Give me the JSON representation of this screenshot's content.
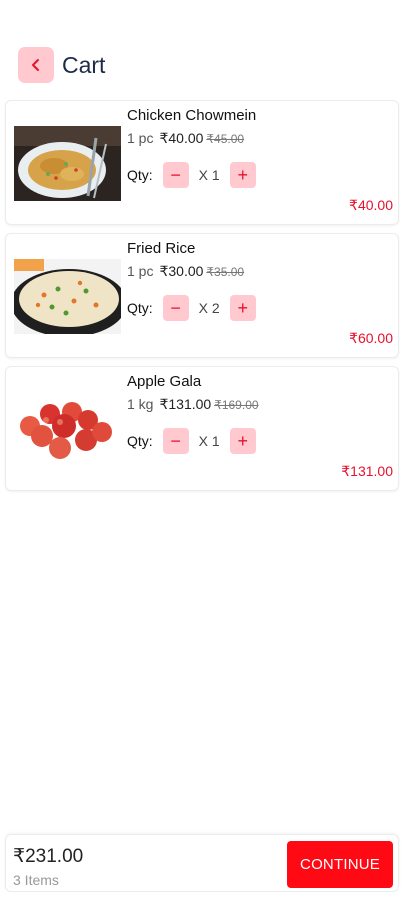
{
  "header": {
    "title": "Cart",
    "back_icon": "chevron-left-icon"
  },
  "items": [
    {
      "name": "Chicken Chowmein",
      "unit": "1 pc",
      "price": "₹40.00",
      "mrp": "₹45.00",
      "qty_label": "Qty:",
      "qty_x": "X",
      "qty": "1",
      "line_total": "₹40.00",
      "image": "chowmein-image"
    },
    {
      "name": "Fried Rice",
      "unit": "1 pc",
      "price": "₹30.00",
      "mrp": "₹35.00",
      "qty_label": "Qty:",
      "qty_x": "X",
      "qty": "2",
      "line_total": "₹60.00",
      "image": "fried-rice-image"
    },
    {
      "name": "Apple Gala",
      "unit": "1 kg",
      "price": "₹131.00",
      "mrp": "₹169.00",
      "qty_label": "Qty:",
      "qty_x": "X",
      "qty": "1",
      "line_total": "₹131.00",
      "image": "apples-image"
    }
  ],
  "footer": {
    "total": "₹231.00",
    "count": "3 Items",
    "continue_label": "CONTINUE"
  },
  "colors": {
    "accent": "#ff0a14",
    "accent_light": "#ffc9cf",
    "price_red": "#e8112d",
    "title_navy": "#1c2b4a"
  }
}
